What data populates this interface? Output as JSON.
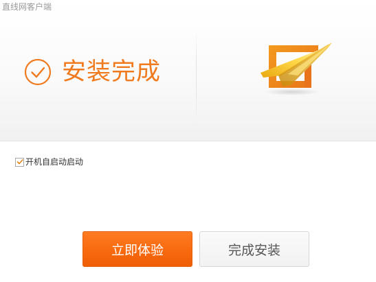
{
  "window": {
    "title": "直线网客户端"
  },
  "banner": {
    "status_text": "安装完成",
    "status_icon": "check-circle-icon",
    "logo_icon": "zhixian-logo-icon"
  },
  "options": {
    "autostart_label": "开机自启动启动",
    "autostart_checked": true
  },
  "actions": {
    "experience_label": "立即体验",
    "finish_label": "完成安装"
  },
  "colors": {
    "accent": "#f07a1e",
    "primary_button": "#f86a0f",
    "logo_gold": "#f2c22b"
  }
}
